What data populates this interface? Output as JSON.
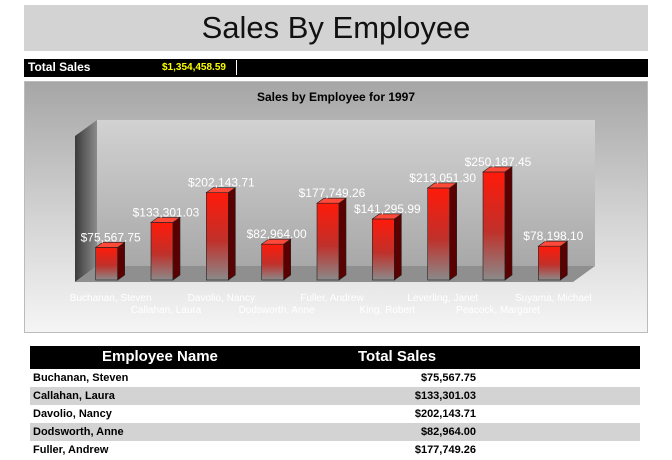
{
  "report": {
    "title": "Sales By Employee",
    "total_label": "Total Sales",
    "total_value": "$1,354,458.59"
  },
  "chart_data": {
    "type": "bar",
    "title": "Sales by Employee for 1997",
    "categories": [
      "Buchanan, Steven",
      "Callahan, Laura",
      "Davolio, Nancy",
      "Dodsworth, Anne",
      "Fuller, Andrew",
      "King, Robert",
      "Leverling, Janet",
      "Peacock, Margaret",
      "Suyama, Michael"
    ],
    "values": [
      75567.75,
      133301.03,
      202143.71,
      82964.0,
      177749.26,
      141295.99,
      213051.3,
      250187.45,
      78198.1
    ],
    "value_labels": [
      "$75,567.75",
      "$133,301.03",
      "$202,143.71",
      "$82,964.00",
      "$177,749.26",
      "$141,295.99",
      "$213,051.30",
      "$250,187.45",
      "$78,198.10"
    ],
    "bar_color": "#e8140c",
    "style": "3d",
    "grid": false,
    "legend": "none"
  },
  "table": {
    "headers": [
      "Employee Name",
      "Total Sales"
    ],
    "rows": [
      [
        "Buchanan, Steven",
        "$75,567.75"
      ],
      [
        "Callahan, Laura",
        "$133,301.03"
      ],
      [
        "Davolio, Nancy",
        "$202,143.71"
      ],
      [
        "Dodsworth, Anne",
        "$82,964.00"
      ],
      [
        "Fuller, Andrew",
        "$177,749.26"
      ]
    ]
  }
}
